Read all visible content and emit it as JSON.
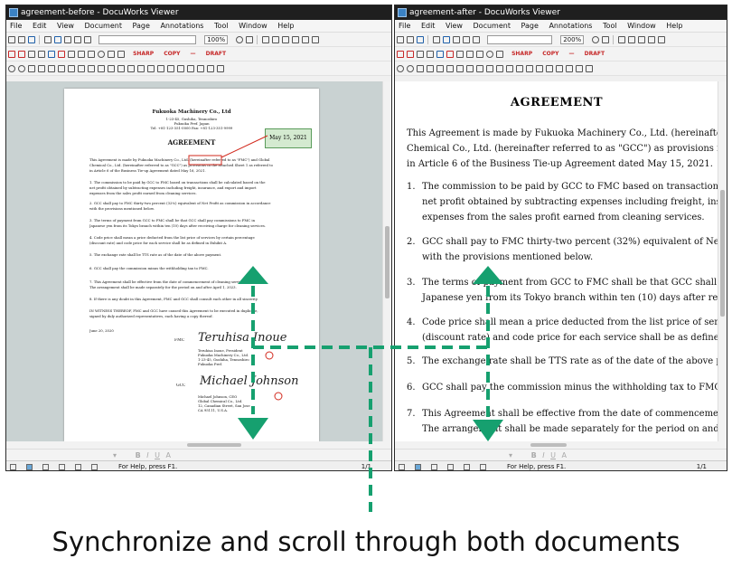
{
  "colors": {
    "accent": "#16a06f",
    "redline": "#d22a1e",
    "callout": "#d4ead0"
  },
  "windows": {
    "left": {
      "title": "agreement-before - DocuWorks Viewer",
      "zoom": "100%",
      "status": "For Help, press F1.",
      "page": "1/1"
    },
    "right": {
      "title": "agreement-after - DocuWorks Viewer",
      "zoom": "200%",
      "status": "For Help, press F1.",
      "page": "1/1"
    }
  },
  "menu": [
    "File",
    "Edit",
    "View",
    "Document",
    "Page",
    "Annotations",
    "Tool",
    "Window",
    "Help"
  ],
  "toolbar": {
    "stamps": [
      "SHARP",
      "COPY",
      "DRAFT"
    ],
    "format_labels": [
      "B",
      "I",
      "U",
      "A"
    ]
  },
  "left_doc": {
    "company": "Fukuoka Machinery Co., Ltd",
    "address_lines": [
      "1-23-45, Gushiha, Tennoshiro",
      "Fukuoka Pref. Japan",
      "Tel: +81-123-351-0000   Fax: +81-123-351-9999"
    ],
    "title": "AGREEMENT",
    "callout": "May 15, 2021",
    "lines": [
      "This Agreement is made by Fukuoka Machinery Co., Ltd. (hereinafter referred to as \"FMC\") and Global",
      "Chemical Co., Ltd. (hereinafter referred to as \"GCC\") as provisions in the attached Sheet 1 as referred to",
      "in Article 6 of the Business Tie-up Agreement dated May 16, 2021.",
      "1.   The commission to be paid by GCC to FMC based on transactions shall be calculated based on the",
      "      net profit obtained by subtracting expenses including freight, insurance, and export and import",
      "      expenses from the sales profit earned from cleaning services.",
      "2.   GCC shall pay to FMC thirty-two percent (32%) equivalent of Net Profit as commission in accordance",
      "      with the provisions mentioned below.",
      "3.   The terms of payment from GCC to FMC shall be that GCC shall pay commissions to FMC in",
      "      Japanese yen from its Tokyo branch within ten (10) days after receiving charge for cleaning services.",
      "4.   Code price shall mean a price deducted from the list price of services by certain percentage",
      "      (discount rate) and code price for each service shall be as defined in Exhibit A.",
      "5.   The exchange rate shall be TTS rate as of the date of the above payment.",
      "6.   GCC shall pay the commission minus the withholding tax to FMC.",
      "7.   This Agreement shall be effective from the date of commencement of cleaning services.",
      "      The arrangement shall be made separately for the period on and after April 1, 2023.",
      "8.   If there is any doubt in this Agreement, FMC and GCC shall consult each other in all sincerity.",
      "IN WITNESS THEREOF, FMC and GCC have caused this Agreement to be executed in duplicate,",
      "signed by duly authorized representatives, each having a copy thereof.",
      "June 20, 2020"
    ],
    "fmc_label": "FMC",
    "gcc_label": "GCC",
    "fmc_signature": "Teruhisa Inoue",
    "gcc_signature": "Michael Johnson",
    "fmc_block": [
      "Teruhisa Inoue, President",
      "Fukuoka Machinery Co., Ltd.",
      "1-23-45, Gushiha, Tennoshiro",
      "Fukuoka Pref."
    ],
    "gcc_block": [
      "Michael Johnson, CEO",
      "Global Chemical Co., Ltd.",
      "12, Canadian Street, San Jose",
      "CA 95111, U.S.A."
    ]
  },
  "right_doc": {
    "title": "AGREEMENT",
    "intro": [
      "This Agreement is made by Fukuoka Machinery Co., Ltd. (hereinafter referred",
      "Chemical Co., Ltd. (hereinafter referred to as \"GCC\") as provisions in the Attach",
      "in Article 6 of the Business Tie-up Agreement dated May 15, 2021."
    ],
    "items": [
      {
        "n": "1.",
        "lines": [
          "The commission to be paid by GCC to FMC based on transactions shall be",
          "net profit obtained by subtracting expenses including freight, insurance,",
          "expenses from the sales profit earned from cleaning services."
        ]
      },
      {
        "n": "2.",
        "lines": [
          "GCC shall pay to FMC thirty-two percent (32%) equivalent of Net Profit as c",
          "with the provisions mentioned below."
        ]
      },
      {
        "n": "3.",
        "lines": [
          "The terms of payment from GCC to FMC shall be that GCC shall pay",
          "Japanese yen from its Tokyo branch within ten (10) days after receiving cha"
        ]
      },
      {
        "n": "4.",
        "lines": [
          "Code price shall mean a price deducted from the list price of services by cert",
          "(discount rate) and code price for each service shall be as defined in Exhibit"
        ]
      },
      {
        "n": "5.",
        "lines": [
          "The exchange rate shall be TTS rate as of the date of the above payment."
        ]
      },
      {
        "n": "6.",
        "lines": [
          "GCC shall pay the commission minus the withholding tax to FMC."
        ]
      },
      {
        "n": "7.",
        "lines": [
          "This Agreement shall be effective from the date of commencement of cleanin",
          "The arrangement shall be made separately for the period on and after April"
        ]
      }
    ]
  },
  "caption": "Synchronize and scroll through both documents"
}
